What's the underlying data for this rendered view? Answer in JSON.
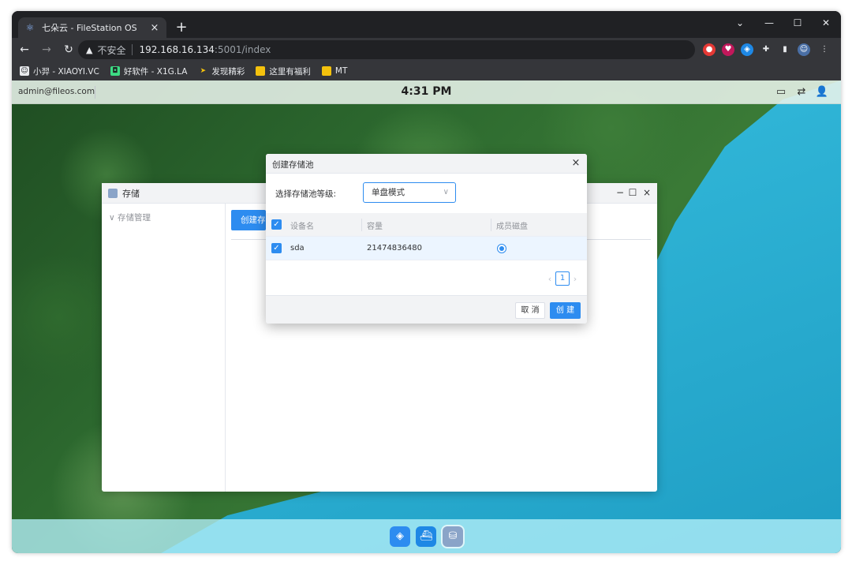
{
  "browser": {
    "tab_title": "七朵云 - FileStation OS",
    "tab_favicon": "react-atom-icon",
    "new_tab": "+",
    "url_insecure_label": "不安全",
    "url_host": "192.168.16.134",
    "url_path": ":5001/index",
    "bookmarks": [
      {
        "label": "小羿 - XIAOYI.VC",
        "icon": "user-circle-icon",
        "color": "#e8eaed"
      },
      {
        "label": "好软件 - X1G.LA",
        "icon": "app-icon",
        "color": "#3ddc84"
      },
      {
        "label": "发现精彩",
        "icon": "arrow-icon",
        "color": "#f4c20d"
      },
      {
        "label": "这里有福利",
        "icon": "folder-icon",
        "color": "#f4c20d"
      },
      {
        "label": "MT",
        "icon": "folder-icon",
        "color": "#f4c20d"
      }
    ]
  },
  "os": {
    "user": "admin@fileos.com",
    "clock": "4:31 PM"
  },
  "storage_window": {
    "title": "存储",
    "sidebar_item": "存储管理",
    "create_button": "创建存储池"
  },
  "dialog": {
    "title": "创建存储池",
    "level_label": "选择存储池等级:",
    "level_value": "单盘模式",
    "columns": [
      "设备名",
      "容量",
      "成员磁盘"
    ],
    "rows": [
      {
        "device": "sda",
        "capacity": "21474836480",
        "checked": true,
        "member": true
      }
    ],
    "page": "1",
    "cancel": "取 消",
    "ok": "创 建"
  },
  "colors": {
    "accent": "#2d8cf0",
    "selected_row": "#ecf5ff"
  }
}
